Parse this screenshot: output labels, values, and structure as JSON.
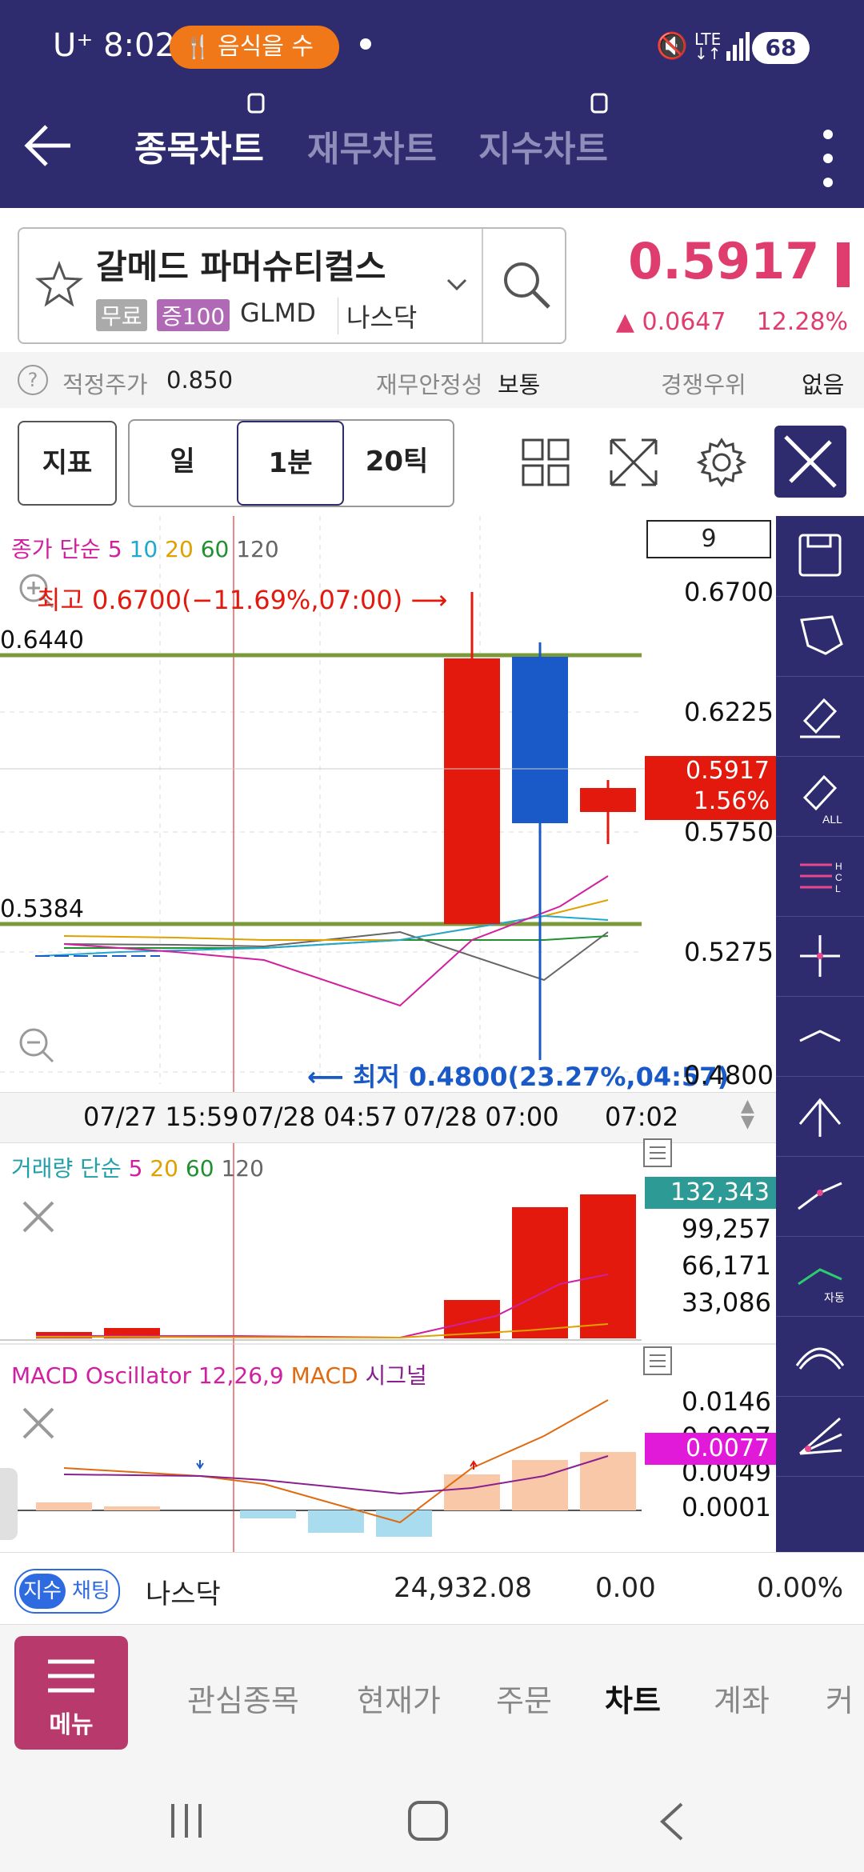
{
  "status": {
    "carrier": "U⁺",
    "time": "8:02",
    "notification": "음식을 수",
    "battery": "68"
  },
  "header": {
    "tabs": [
      "종목차트",
      "재무차트",
      "지수차트"
    ]
  },
  "stock": {
    "name": "갈메드 파머슈티컬스",
    "badge_free": "무료",
    "badge_margin": "증100",
    "ticker": "GLMD",
    "market": "나스닥",
    "price": "0.5917",
    "change": "▲ 0.0647",
    "change_pct": "12.28%"
  },
  "info": {
    "fair_label": "적정주가",
    "fair_value": "0.850",
    "stability_label": "재무안정성",
    "stability_value": "보통",
    "competitive_label": "경쟁우위",
    "competitive_value": "없음"
  },
  "toolbar": {
    "indicator": "지표",
    "day": "일",
    "minute": "1분",
    "tick": "20틱"
  },
  "price_chart": {
    "legend_prefix": "종가 단순",
    "legend_5": "5",
    "legend_10": "10",
    "legend_20": "20",
    "legend_60": "60",
    "legend_120": "120",
    "period_box": "9",
    "high_label": "최고 0.6700(−11.69%,07:00)",
    "low_label": "최저 0.4800(23.27%,04:57)",
    "line_upper": "0.6440",
    "line_lower": "0.5384",
    "y_ticks": [
      "0.6700",
      "0.6225",
      "0.5750",
      "0.5275",
      "0.4800"
    ],
    "current_price": "0.5917",
    "current_pct": "1.56%",
    "x_labels": [
      "07/27 15:59",
      "07/28 04:57",
      "07/28 07:00",
      "07:02"
    ],
    "colors": {
      "up": "#e3190d",
      "down": "#1959c8",
      "ma5": "#d020a0",
      "ma10": "#20a8d0",
      "ma20": "#e0a000",
      "ma60": "#209030",
      "ma120": "#666666",
      "hline": "#7a9a3a"
    }
  },
  "volume_chart": {
    "legend_prefix": "거래량 단순",
    "legend_5": "5",
    "legend_20": "20",
    "legend_60": "60",
    "legend_120": "120",
    "current": "132,343",
    "y_ticks": [
      "99,257",
      "66,171",
      "33,086"
    ]
  },
  "macd_chart": {
    "legend_osc": "MACD Oscillator 12,26,9",
    "legend_macd": "MACD",
    "legend_signal": "시그널",
    "current": "0.0077",
    "y_ticks": [
      "0.0146",
      "0.0097",
      "0.0049",
      "0.0001"
    ]
  },
  "index_bar": {
    "badge1": "지수",
    "badge2": "채팅",
    "name": "나스닥",
    "value": "24,932.08",
    "change": "0.00",
    "pct": "0.00%"
  },
  "nav": {
    "menu": "메뉴",
    "items": [
      "관심종목",
      "현재가",
      "주문",
      "차트",
      "계좌",
      "커"
    ]
  }
}
